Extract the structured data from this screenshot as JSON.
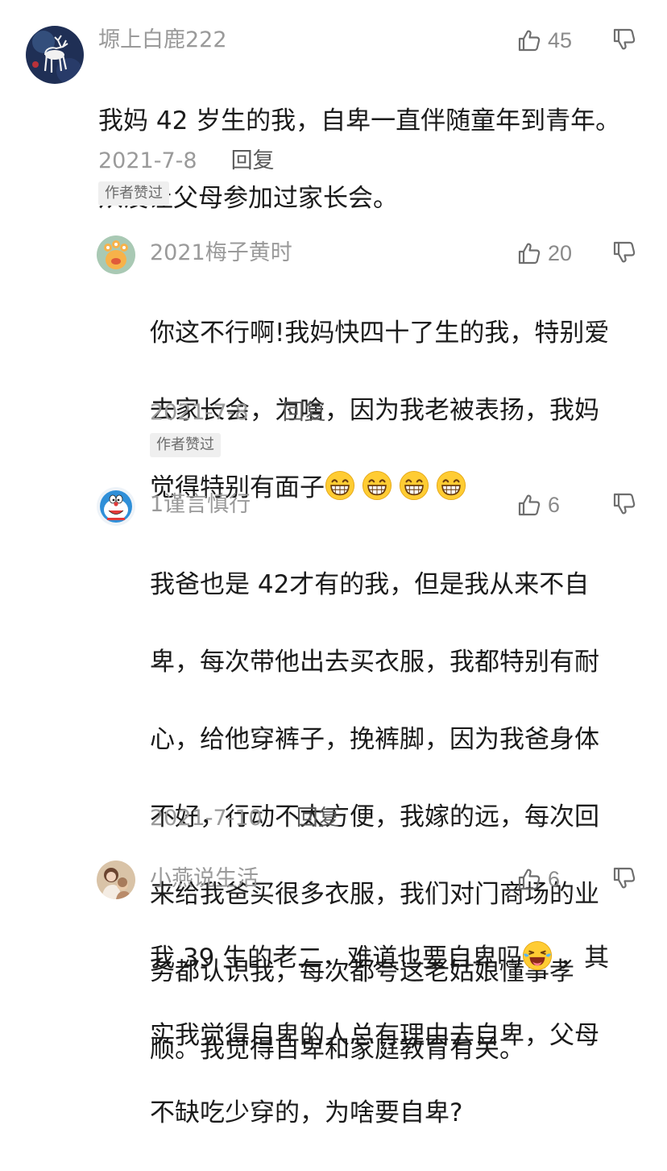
{
  "comments": [
    {
      "username": "塬上白鹿222",
      "likes": "45",
      "lines": [
        "我妈 42 岁生的我，自卑一直伴随童年到青年。",
        "从没让父母参加过家长会。"
      ],
      "date": "2021-7-8",
      "reply_label": "回复",
      "badge": "作者赞过"
    },
    {
      "username": "2021梅子黄时",
      "likes": "20",
      "lines": [
        "你这不行啊!我妈快四十了生的我，特别爱",
        "去家长会，为啥，因为我老被表扬，我妈",
        "觉得特别有面子"
      ],
      "emoji": "grinning-face-emoji",
      "date": "2021-7-8",
      "reply_label": "回复",
      "badge": "作者赞过"
    },
    {
      "username": "1谨言慎行",
      "likes": "6",
      "lines": [
        "我爸也是 42才有的我，但是我从来不自",
        "卑，每次带他出去买衣服，我都特别有耐",
        "心，给他穿裤子，挽裤脚，因为我爸身体",
        "不好，行动不太方便，我嫁的远，每次回",
        "来给我爸买很多衣服，我们对门商场的业",
        "务都认识我，每次都夸这老姑娘懂事孝",
        "顺。我觉得自卑和家庭教育有关。"
      ],
      "date": "2021-7-10",
      "reply_label": "回复"
    },
    {
      "username": "小燕说生活",
      "likes": "6",
      "lines": [
        "我 39 生的老二，难道也要自卑吗",
        "，其",
        "实我觉得自卑的人总有理由去自卑，父母",
        "不缺吃少穿的，为啥要自卑?"
      ],
      "emoji": "crying-laughing-emoji"
    }
  ],
  "icons": {
    "like": "thumbs-up-icon",
    "dislike": "thumbs-down-icon"
  },
  "colors": {
    "username": "#9a9a9a",
    "body_text": "#1b1b1b",
    "badge_bg": "#efefef"
  }
}
